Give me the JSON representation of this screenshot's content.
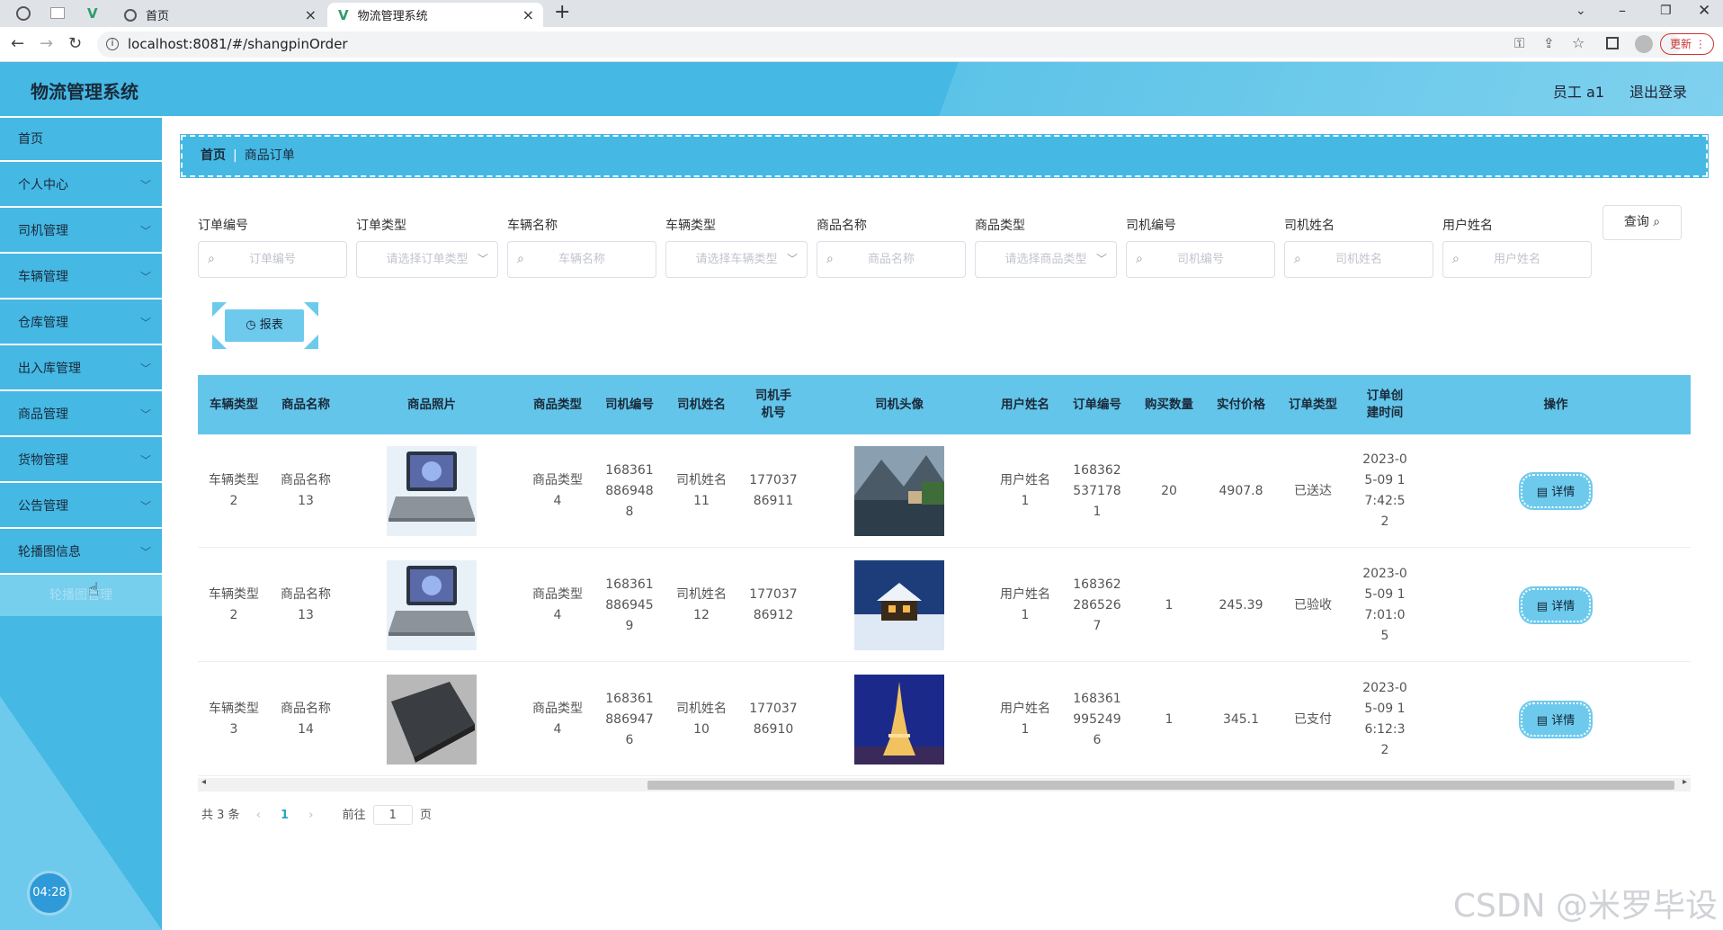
{
  "browser": {
    "tabs": [
      {
        "title": "首页"
      },
      {
        "title": "物流管理系统"
      }
    ],
    "url": "localhost:8081/#/shangpinOrder",
    "update_label": "更新"
  },
  "app": {
    "title": "物流管理系统",
    "user": "员工 a1",
    "logout": "退出登录"
  },
  "sidebar": {
    "items": [
      {
        "label": "首页"
      },
      {
        "label": "个人中心"
      },
      {
        "label": "司机管理"
      },
      {
        "label": "车辆管理"
      },
      {
        "label": "仓库管理"
      },
      {
        "label": "出入库管理"
      },
      {
        "label": "商品管理"
      },
      {
        "label": "货物管理"
      },
      {
        "label": "公告管理"
      },
      {
        "label": "轮播图信息"
      }
    ],
    "sub_item": "轮播图管理",
    "timer": "04:28"
  },
  "breadcrumb": {
    "home": "首页",
    "current": "商品订单"
  },
  "filters": [
    {
      "label": "订单编号",
      "placeholder": "订单编号",
      "type": "input"
    },
    {
      "label": "订单类型",
      "placeholder": "请选择订单类型",
      "type": "select"
    },
    {
      "label": "车辆名称",
      "placeholder": "车辆名称",
      "type": "input"
    },
    {
      "label": "车辆类型",
      "placeholder": "请选择车辆类型",
      "type": "select"
    },
    {
      "label": "商品名称",
      "placeholder": "商品名称",
      "type": "input"
    },
    {
      "label": "商品类型",
      "placeholder": "请选择商品类型",
      "type": "select"
    },
    {
      "label": "司机编号",
      "placeholder": "司机编号",
      "type": "input"
    },
    {
      "label": "司机姓名",
      "placeholder": "司机姓名",
      "type": "input"
    },
    {
      "label": "用户姓名",
      "placeholder": "用户姓名",
      "type": "input"
    }
  ],
  "query_label": "查询",
  "report_label": "报表",
  "table": {
    "headers": [
      "车辆类型",
      "商品名称",
      "商品照片",
      "商品类型",
      "司机编号",
      "司机姓名",
      "司机手机号",
      "司机头像",
      "用户姓名",
      "订单编号",
      "购买数量",
      "实付价格",
      "订单类型",
      "订单创建时间",
      "操作"
    ],
    "rows": [
      {
        "car_type": "车辆类型2",
        "product": "商品名称13",
        "photo": "laptop",
        "product_type": "商品类型4",
        "driver_no": "1683618869488",
        "driver": "司机姓名11",
        "phone": "17703786911",
        "avatar": "lake-village",
        "user": "用户姓名1",
        "order_no": "1683625371781",
        "qty": "20",
        "price": "4907.8",
        "status": "已送达",
        "time": "2023-05-09 17:42:52",
        "action": "详情"
      },
      {
        "car_type": "车辆类型2",
        "product": "商品名称13",
        "photo": "laptop",
        "product_type": "商品类型4",
        "driver_no": "1683618869459",
        "driver": "司机姓名12",
        "phone": "17703786912",
        "avatar": "snow-cabin",
        "user": "用户姓名1",
        "order_no": "1683622865267",
        "qty": "1",
        "price": "245.39",
        "status": "已验收",
        "time": "2023-05-09 17:01:05",
        "action": "详情"
      },
      {
        "car_type": "车辆类型3",
        "product": "商品名称14",
        "photo": "laptop-closed",
        "product_type": "商品类型4",
        "driver_no": "1683618869476",
        "driver": "司机姓名10",
        "phone": "17703786910",
        "avatar": "eiffel-tower",
        "user": "用户姓名1",
        "order_no": "1683619952496",
        "qty": "1",
        "price": "345.1",
        "status": "已支付",
        "time": "2023-05-09 16:12:32",
        "action": "详情"
      }
    ]
  },
  "pagination": {
    "total": "共 3 条",
    "current": "1",
    "goto_prefix": "前往",
    "goto_value": "1",
    "goto_suffix": "页"
  },
  "watermark": "CSDN @米罗毕设"
}
